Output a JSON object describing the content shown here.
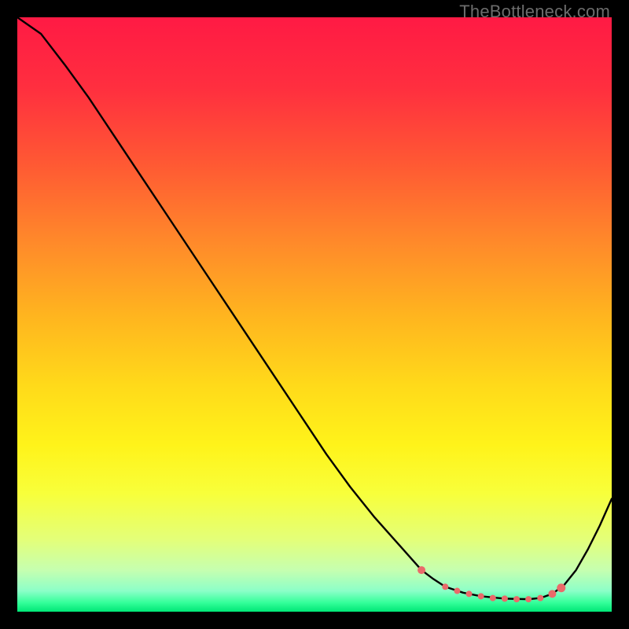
{
  "watermark": "TheBottleneck.com",
  "chart_data": {
    "type": "line",
    "title": "",
    "xlabel": "",
    "ylabel": "",
    "xlim": [
      0,
      100
    ],
    "ylim": [
      0,
      100
    ],
    "grid": false,
    "legend": false,
    "background_gradient": {
      "stops": [
        {
          "offset": 0.0,
          "color": "#ff1a44"
        },
        {
          "offset": 0.12,
          "color": "#ff2f3f"
        },
        {
          "offset": 0.25,
          "color": "#ff5a33"
        },
        {
          "offset": 0.38,
          "color": "#ff8a2a"
        },
        {
          "offset": 0.5,
          "color": "#ffb41f"
        },
        {
          "offset": 0.62,
          "color": "#ffda1a"
        },
        {
          "offset": 0.72,
          "color": "#fff31a"
        },
        {
          "offset": 0.8,
          "color": "#f8ff3a"
        },
        {
          "offset": 0.88,
          "color": "#e3ff7a"
        },
        {
          "offset": 0.93,
          "color": "#c6ffb0"
        },
        {
          "offset": 0.965,
          "color": "#8cffc8"
        },
        {
          "offset": 0.985,
          "color": "#33ff99"
        },
        {
          "offset": 1.0,
          "color": "#00e676"
        }
      ]
    },
    "series": [
      {
        "name": "curve",
        "color": "#000000",
        "x": [
          0,
          4,
          8,
          12,
          16,
          20,
          24,
          28,
          32,
          36,
          40,
          44,
          48,
          52,
          56,
          60,
          64,
          68,
          70,
          72,
          75,
          78,
          82,
          86,
          88,
          90,
          92,
          94,
          96,
          98,
          100
        ],
        "y": [
          100,
          97.2,
          92.0,
          86.5,
          80.5,
          74.5,
          68.5,
          62.5,
          56.5,
          50.5,
          44.5,
          38.5,
          32.5,
          26.5,
          21.0,
          16.0,
          11.5,
          7.0,
          5.5,
          4.2,
          3.2,
          2.6,
          2.2,
          2.1,
          2.3,
          3.0,
          4.5,
          7.0,
          10.5,
          14.5,
          19.0
        ]
      }
    ],
    "markers": {
      "name": "bottleneck-band",
      "color": "#ea6a6a",
      "radius_main": 4.5,
      "radius_accent": 6.0,
      "points": [
        {
          "x": 68,
          "y": 7.0,
          "r": 5.0
        },
        {
          "x": 72,
          "y": 4.2,
          "r": 4.0
        },
        {
          "x": 74,
          "y": 3.5,
          "r": 4.0
        },
        {
          "x": 76,
          "y": 3.0,
          "r": 4.0
        },
        {
          "x": 78,
          "y": 2.6,
          "r": 4.0
        },
        {
          "x": 80,
          "y": 2.3,
          "r": 4.0
        },
        {
          "x": 82,
          "y": 2.2,
          "r": 4.0
        },
        {
          "x": 84,
          "y": 2.1,
          "r": 4.0
        },
        {
          "x": 86,
          "y": 2.1,
          "r": 4.0
        },
        {
          "x": 88,
          "y": 2.3,
          "r": 4.0
        },
        {
          "x": 90,
          "y": 3.0,
          "r": 5.0
        },
        {
          "x": 91.5,
          "y": 4.0,
          "r": 5.5
        }
      ]
    }
  }
}
